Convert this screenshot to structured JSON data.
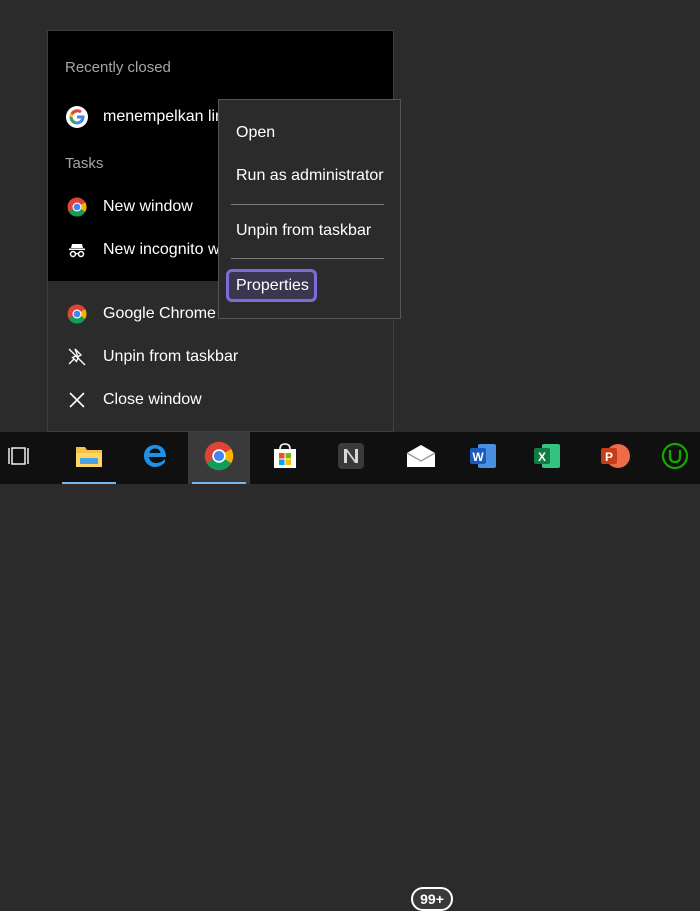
{
  "jumplist": {
    "recently_closed_header": "Recently closed",
    "recent_item": "menempelkan lir",
    "tasks_header": "Tasks",
    "tasks": [
      "New window",
      "New incognito w"
    ],
    "app_name": "Google Chrome",
    "unpin": "Unpin from taskbar",
    "close": "Close window"
  },
  "context_menu": {
    "open": "Open",
    "run_admin": "Run as administrator",
    "unpin": "Unpin from taskbar",
    "properties": "Properties"
  },
  "taskbar": {
    "mail_badge": "99+",
    "apps": [
      "task-view",
      "file-explorer",
      "edge",
      "chrome",
      "store",
      "notion",
      "mail",
      "word",
      "excel",
      "powerpoint",
      "upwork"
    ]
  },
  "colors": {
    "accent_focus": "#7b6cd9",
    "taskbar_bg": "#101010",
    "menu_bg": "#2b2b2b"
  }
}
